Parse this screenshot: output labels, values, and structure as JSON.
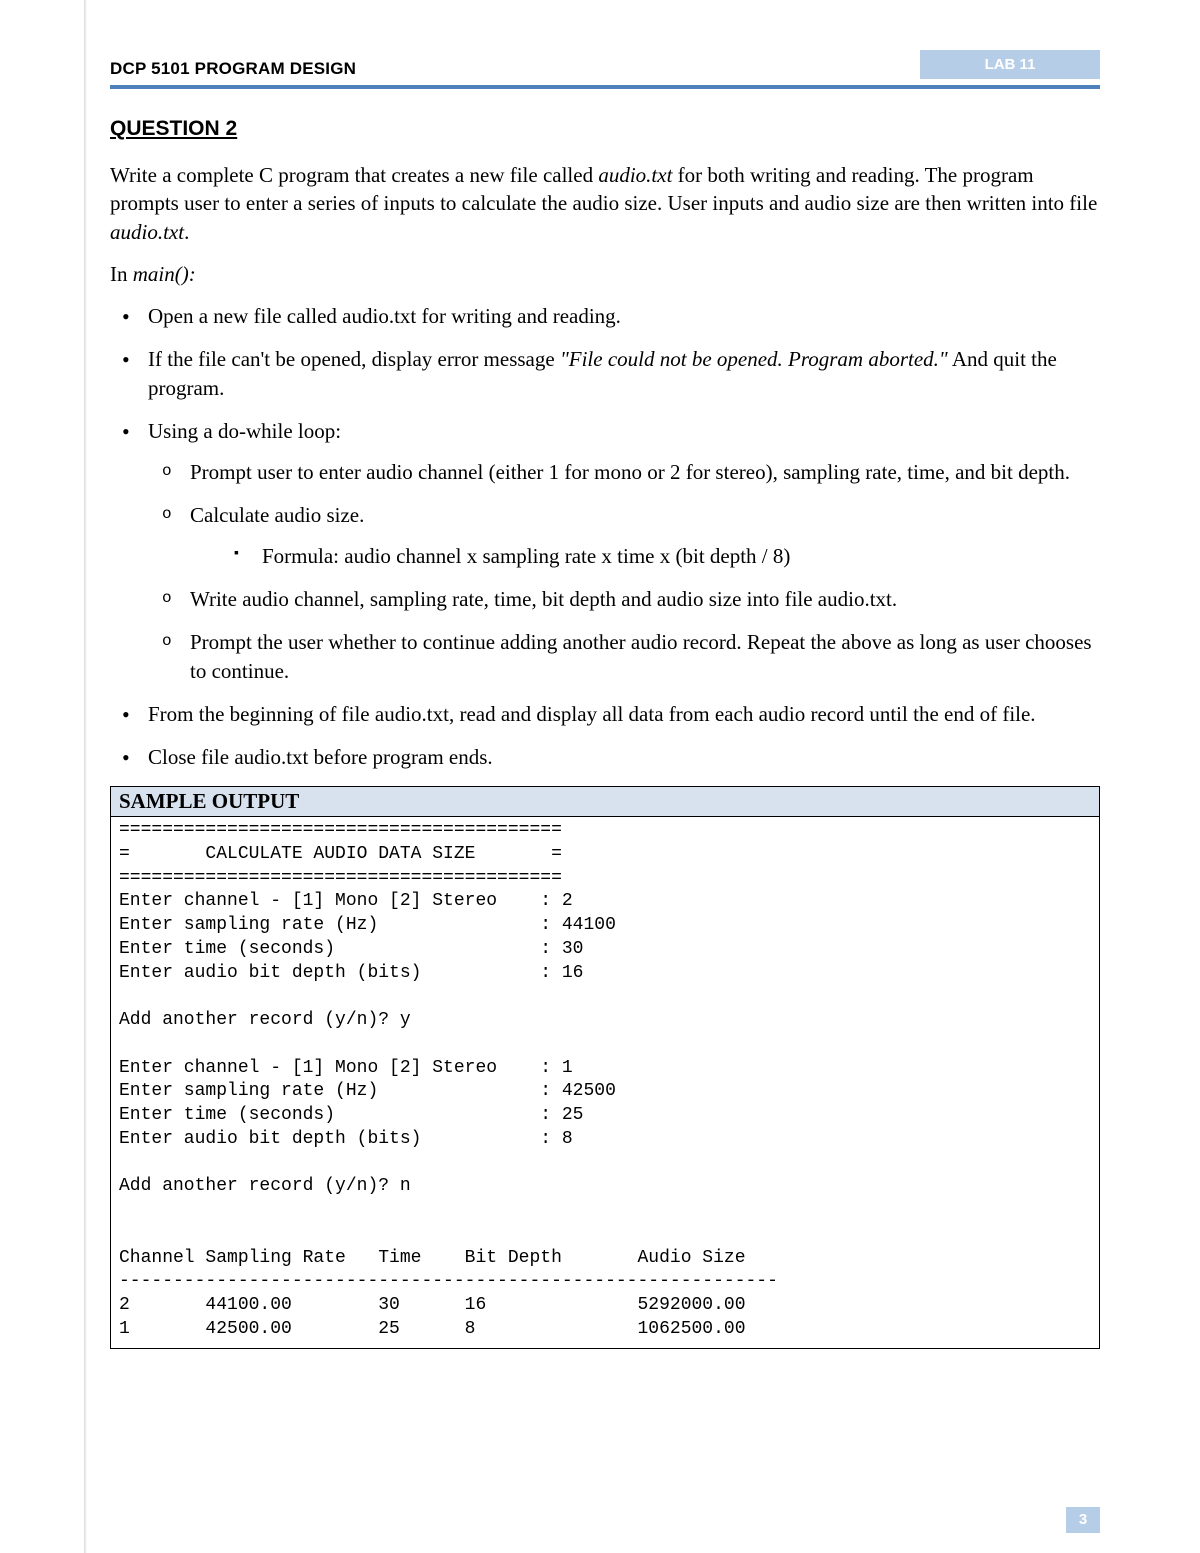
{
  "header": {
    "course": "DCP 5101 PROGRAM DESIGN",
    "lab": "LAB 11"
  },
  "question": {
    "title": "QUESTION 2",
    "intro_parts": {
      "p1a": "Write a complete C program that creates a new file called ",
      "p1_file1": "audio.txt",
      "p1b": " for both writing and reading. The program prompts user to enter a series of inputs to calculate the audio size. User inputs and audio size are then written into file ",
      "p1_file2": "audio.txt",
      "p1c": "."
    },
    "in_main_label_a": "In ",
    "in_main_label_b": "main():",
    "bullets": {
      "b1": "Open a new file called audio.txt for writing and reading.",
      "b2a": "If the file can't be opened, display error message ",
      "b2_msg": "\"File could not be opened. Program aborted.\"",
      "b2b": " And quit the program.",
      "b3": "Using a do-while loop:",
      "b3_1": "Prompt user to enter audio channel (either 1 for mono or 2 for stereo), sampling rate, time, and bit depth.",
      "b3_2": "Calculate audio size.",
      "b3_2_1": "Formula: audio channel x sampling rate x time x (bit depth / 8)",
      "b3_3": "Write audio channel, sampling rate, time, bit depth and audio size into file audio.txt.",
      "b3_4": "Prompt the user whether to continue adding another audio record. Repeat the above as long as user chooses to continue.",
      "b4": "From the beginning of file audio.txt, read and display all data from each audio record until the end of file.",
      "b5": "Close file audio.txt before program ends."
    }
  },
  "sample": {
    "title": "SAMPLE OUTPUT",
    "body": "=========================================\n=       CALCULATE AUDIO DATA SIZE       =\n=========================================\nEnter channel - [1] Mono [2] Stereo    : 2\nEnter sampling rate (Hz)               : 44100\nEnter time (seconds)                   : 30\nEnter audio bit depth (bits)           : 16\n\nAdd another record (y/n)? y\n\nEnter channel - [1] Mono [2] Stereo    : 1\nEnter sampling rate (Hz)               : 42500\nEnter time (seconds)                   : 25\nEnter audio bit depth (bits)           : 8\n\nAdd another record (y/n)? n\n\n\nChannel Sampling Rate   Time    Bit Depth       Audio Size\n-------------------------------------------------------------\n2       44100.00        30      16              5292000.00\n1       42500.00        25      8               1062500.00"
  },
  "page_number": "3"
}
